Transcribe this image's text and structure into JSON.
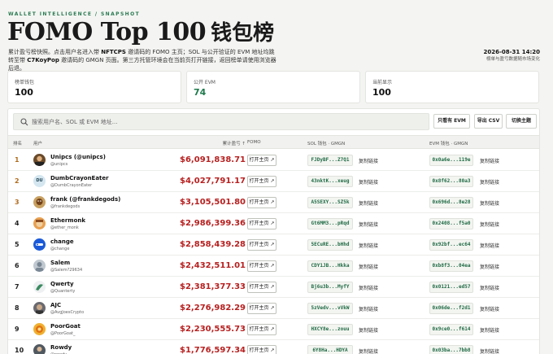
{
  "header": {
    "eyebrow": "WALLET INTELLIGENCE / SNAPSHOT",
    "title_en": "FOMO Top 100",
    "title_zh": "钱包榜",
    "desc_1": "累计盈亏榜快照。点击用户名进入带 ",
    "desc_ref1": "NFTCPS",
    "desc_2": " 邀请码的 FOMO 主页；SOL 与公开验证的 EVM 地址均跳转至带 ",
    "desc_ref2": "C7KoyPop",
    "desc_3": " 邀请码的 GMGN 页面。第三方托管环境会在当前页打开链接，返回榜单请使用浏览器后退。",
    "date": "2026-08-31 14:20",
    "note": "榜单与盈亏数据随市场变化"
  },
  "stats": [
    {
      "label": "榜单钱包",
      "value": "100"
    },
    {
      "label": "公开 EVM",
      "value": "74"
    },
    {
      "label": "当前显示",
      "value": "100"
    }
  ],
  "toolbar": {
    "search_placeholder": "搜索用户名、SOL 或 EVM 地址...",
    "evm_only_label": "只看有 EVM",
    "export_label": "导出 CSV",
    "theme_label": "切换主题"
  },
  "columns": {
    "rank": "排名",
    "user": "用户",
    "pnl": "累计盈亏 ↑",
    "fomo": "FOMO",
    "sol": "SOL 钱包 · GMGN",
    "evm": "EVM 钱包 · GMGN"
  },
  "row_labels": {
    "open": "打开主页 ↗",
    "copy": "复制链接"
  },
  "rows": [
    {
      "rank": "1",
      "name": "Unipcs (@unipcs)",
      "handle": "@unipcs",
      "pnl": "$6,091,838.71",
      "sol": "FJDyBF...Z7Q1",
      "evm": "0x0a6e...119e",
      "avatar": "a",
      "top": true
    },
    {
      "rank": "2",
      "name": "DumbCrayonEater",
      "handle": "@DumbCrayonEater",
      "pnl": "$4,027,791.17",
      "sol": "43nktK...xeug",
      "evm": "0x8f62...80a3",
      "avatar": "DU",
      "top": true
    },
    {
      "rank": "3",
      "name": "frank (@frankdegods)",
      "handle": "@frankdegods",
      "pnl": "$3,105,501.80",
      "sol": "A5SEXY...SZ5k",
      "evm": "0x696d...8e28",
      "avatar": "b",
      "top": true
    },
    {
      "rank": "4",
      "name": "Ethermonk",
      "handle": "@ether_monk",
      "pnl": "$2,986,399.36",
      "sol": "Gt6MM3...pRqd",
      "evm": "0x2408...f5a0",
      "avatar": "c",
      "top": false
    },
    {
      "rank": "5",
      "name": "change",
      "handle": "@change",
      "pnl": "$2,858,439.28",
      "sol": "5ECuRE...bHhd",
      "evm": "0x92bf...ec64",
      "avatar": "d",
      "top": false
    },
    {
      "rank": "6",
      "name": "Salem",
      "handle": "@Salem?29634",
      "pnl": "$2,432,511.01",
      "sol": "CDY1JB...Hkka",
      "evm": "0xb8f3...04ea",
      "avatar": "e",
      "top": false
    },
    {
      "rank": "7",
      "name": "Qwerty",
      "handle": "@Quanterty",
      "pnl": "$2,381,377.33",
      "sol": "Bj6u3b...MyfY",
      "evm": "0x0121...ed57",
      "avatar": "f",
      "top": false
    },
    {
      "rank": "8",
      "name": "AJC",
      "handle": "@AvgJoesCrypto",
      "pnl": "$2,276,982.29",
      "sol": "5zVedv...vVkW",
      "evm": "0x06de...f2d1",
      "avatar": "g",
      "top": false
    },
    {
      "rank": "9",
      "name": "PoorGoat",
      "handle": "@PoorGoat_",
      "pnl": "$2,230,555.73",
      "sol": "HXCY8e...zouu",
      "evm": "0x9ce0...f614",
      "avatar": "h",
      "top": false
    },
    {
      "rank": "10",
      "name": "Rowdy",
      "handle": "@rowdy",
      "pnl": "$1,776,597.34",
      "sol": "6Y8Ha...HDYA",
      "evm": "0x03ba...7bb8",
      "avatar": "i",
      "top": false
    }
  ],
  "colors": {
    "accent": "#1f7a4d",
    "pnl": "#b82020",
    "rank_top": "#b06c1f"
  }
}
